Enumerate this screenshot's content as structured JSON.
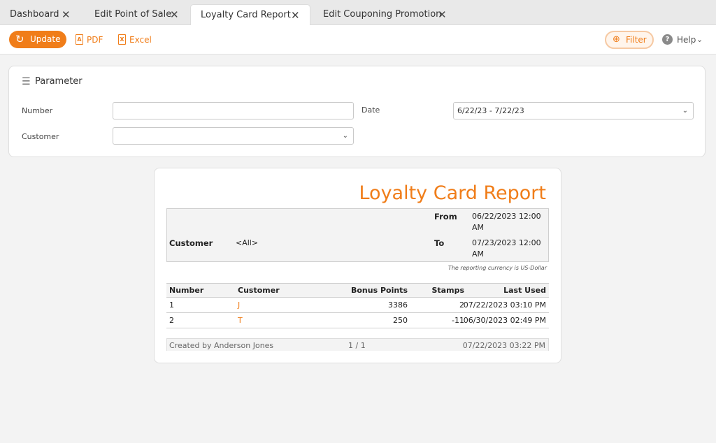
{
  "tabs": [
    {
      "label": "Dashboard"
    },
    {
      "label": "Edit Point of Sale"
    },
    {
      "label": "Loyalty Card Report"
    },
    {
      "label": "Edit Couponing Promotion"
    }
  ],
  "toolbar": {
    "update_label": "Update",
    "pdf_label": "PDF",
    "excel_label": "Excel",
    "filter_label": "Filter",
    "help_label": "Help",
    "accent_color": "#f07d19"
  },
  "parameter": {
    "title": "Parameter",
    "number_label": "Number",
    "number_value": "",
    "customer_label": "Customer",
    "customer_value": "",
    "date_label": "Date",
    "date_value": "6/22/23 - 7/22/23"
  },
  "report": {
    "title": "Loyalty Card Report",
    "customer_label": "Customer",
    "customer_value": "<All>",
    "from_label": "From",
    "from_value_line1": "06/22/2023 12:00",
    "from_value_line2": "AM",
    "to_label": "To",
    "to_value_line1": "07/23/2023 12:00",
    "to_value_line2": "AM",
    "currency_note": "The reporting currency is US-Dollar",
    "columns": {
      "number": "Number",
      "customer": "Customer",
      "bonus_points": "Bonus Points",
      "stamps": "Stamps",
      "last_used": "Last Used"
    },
    "rows": [
      {
        "number": "1",
        "customer": "J",
        "bonus_points": "3386",
        "stamps": "2",
        "last_used": "07/22/2023 03:10 PM"
      },
      {
        "number": "2",
        "customer": "T",
        "bonus_points": "250",
        "stamps": "-11",
        "last_used": "06/30/2023 02:49 PM"
      }
    ],
    "footer": {
      "created_by": "Created by Anderson Jones",
      "page": "1  /  1",
      "timestamp": "07/22/2023 03:22 PM"
    }
  }
}
